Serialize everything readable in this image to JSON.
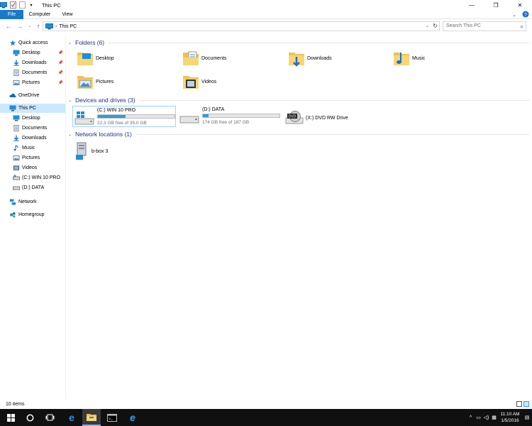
{
  "window": {
    "title": "This PC"
  },
  "ribbon": {
    "tabs": [
      {
        "label": "File"
      },
      {
        "label": "Computer"
      },
      {
        "label": "View"
      }
    ]
  },
  "address": {
    "path": "This PC",
    "search_placeholder": "Search This PC"
  },
  "nav": {
    "items": [
      {
        "label": "Quick access",
        "icon": "star-icon"
      },
      {
        "label": "Desktop",
        "icon": "desktop-icon",
        "pinned": true
      },
      {
        "label": "Downloads",
        "icon": "download-icon",
        "pinned": true
      },
      {
        "label": "Documents",
        "icon": "documents-icon",
        "pinned": true
      },
      {
        "label": "Pictures",
        "icon": "pictures-icon",
        "pinned": true
      },
      {
        "label": "OneDrive",
        "icon": "onedrive-icon"
      },
      {
        "label": "This PC",
        "icon": "computer-icon",
        "selected": true
      },
      {
        "label": "Desktop",
        "icon": "desktop-icon"
      },
      {
        "label": "Documents",
        "icon": "documents-icon"
      },
      {
        "label": "Downloads",
        "icon": "download-icon"
      },
      {
        "label": "Music",
        "icon": "music-icon"
      },
      {
        "label": "Pictures",
        "icon": "pictures-icon"
      },
      {
        "label": "Videos",
        "icon": "videos-icon"
      },
      {
        "label": "(C:) WIN 10 PRO",
        "icon": "drive-icon"
      },
      {
        "label": "(D:) DATA",
        "icon": "drive-icon"
      },
      {
        "label": "Network",
        "icon": "network-icon"
      },
      {
        "label": "Homegroup",
        "icon": "homegroup-icon"
      }
    ]
  },
  "groups": {
    "folders": "Folders (6)",
    "devices": "Devices and drives (3)",
    "network": "Network locations (1)"
  },
  "folders": [
    {
      "label": "Desktop"
    },
    {
      "label": "Documents"
    },
    {
      "label": "Downloads"
    },
    {
      "label": "Music"
    },
    {
      "label": "Pictures"
    },
    {
      "label": "Videos"
    }
  ],
  "drives": [
    {
      "name": "(C:) WIN 10 PRO",
      "free": "22.3 GB free of 35.0 GB",
      "used_fraction": 0.36
    },
    {
      "name": "(D:) DATA",
      "free": "174 GB free of 187 GB",
      "used_fraction": 0.07
    }
  ],
  "dvd": {
    "name": "(X:) DVD RW Drive",
    "badge": "DVD"
  },
  "network_locations": [
    {
      "label": "b-box 3"
    }
  ],
  "status": {
    "count": "10 items"
  },
  "taskbar": {
    "time": "11:10 AM",
    "date": "1/5/2016"
  },
  "colors": {
    "accent": "#1979ca",
    "selection": "#cce8ff",
    "group_heading": "#1e3287",
    "drive_bar": "#26a0da"
  }
}
